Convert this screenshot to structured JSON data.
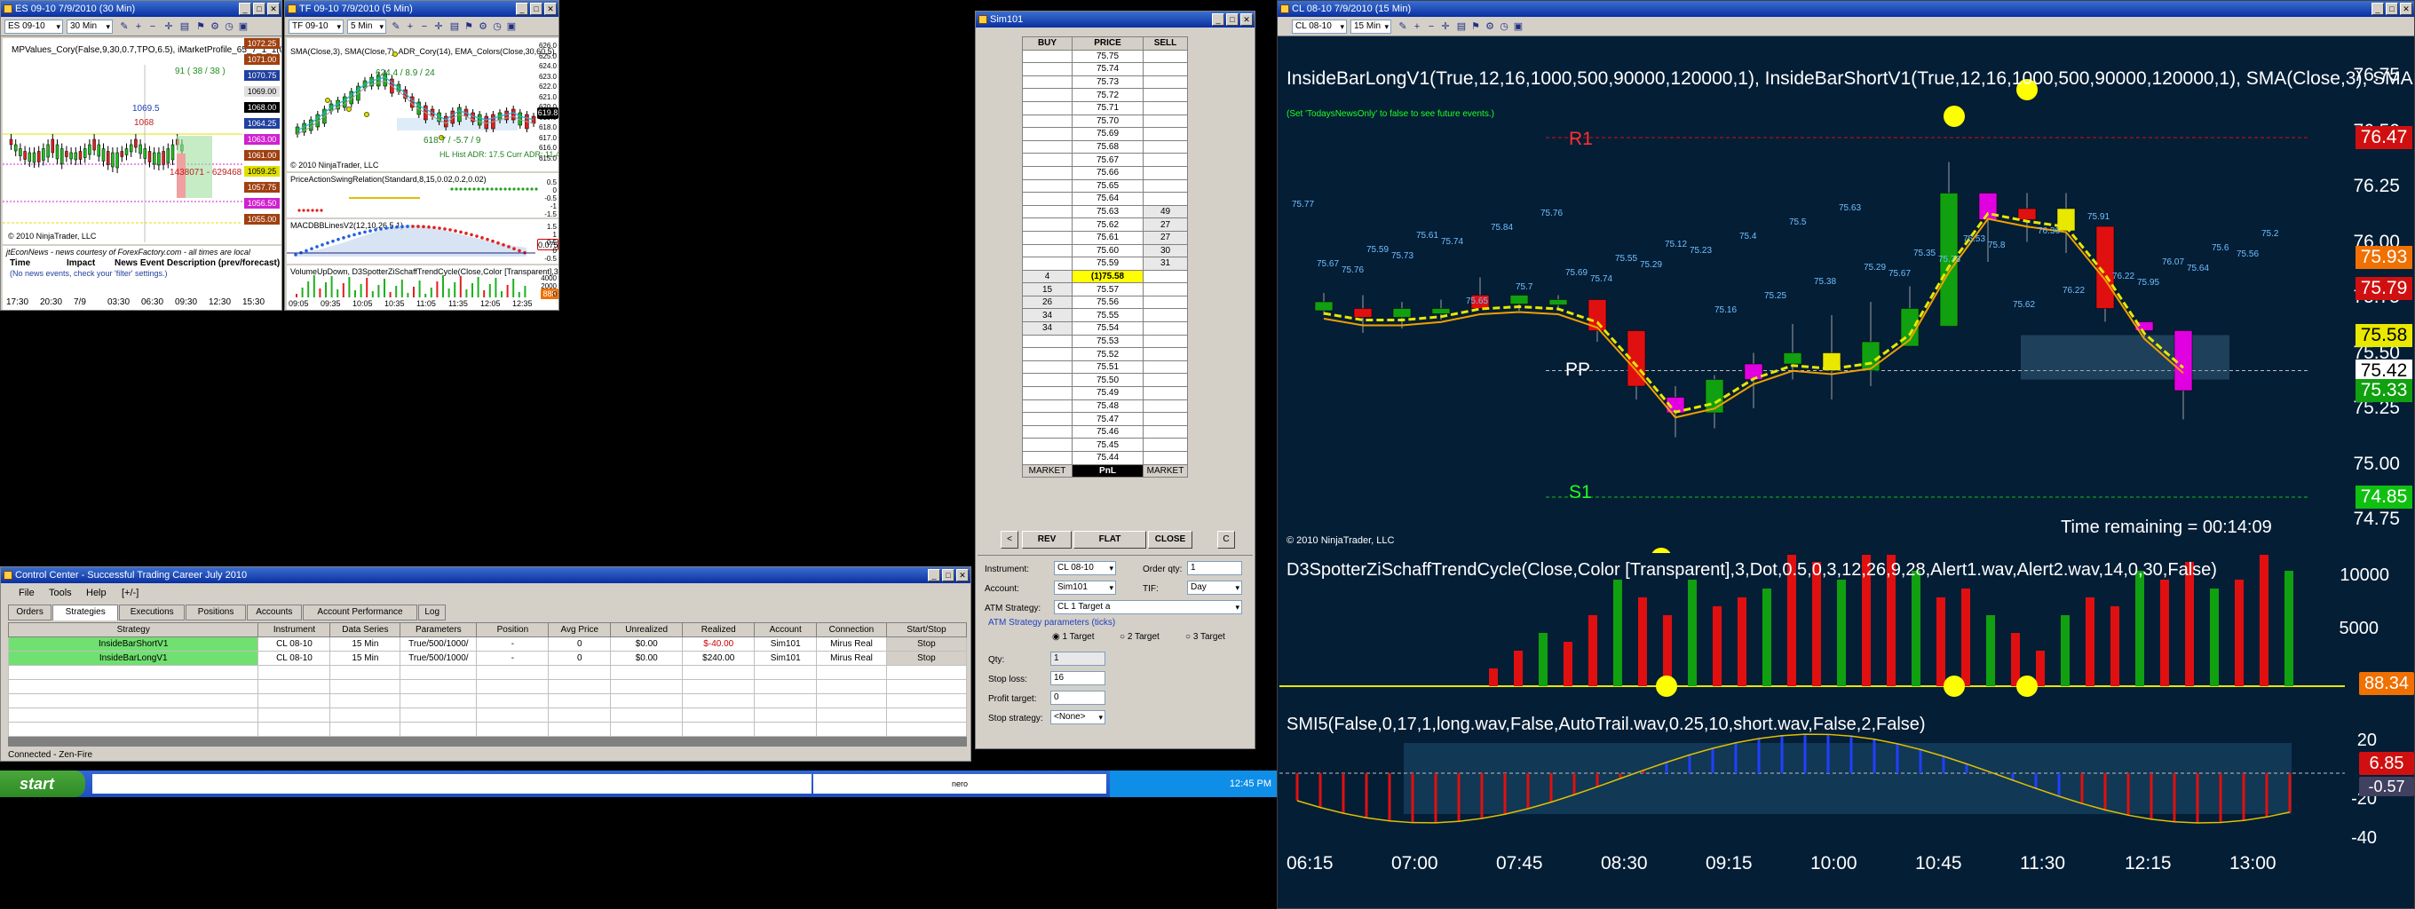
{
  "es_window": {
    "title": "ES 09-10  7/9/2010 (30 Min)",
    "instrument": "ES 09-10",
    "interval": "30 Min",
    "indicator_line": "MPValues_Cory(False,9,30,0.7,TPO,6.5), iMarketProfile_65_7_1_1(0,4,9,30,True,6,5,70)",
    "copyright": "© 2010 NinjaTrader, LLC",
    "price_labels": [
      "1072.25",
      "1071.00",
      "1070.75",
      "1069.00",
      "1068.00",
      "1064.25",
      "1063.00",
      "1061.00",
      "1059.25",
      "1057.75",
      "1056.50",
      "1055.00"
    ],
    "annotations": [
      "91 ( 38 / 38 )",
      "1069.5",
      "1068",
      "1438071 - 629468"
    ],
    "time_axis": [
      "17:30",
      "20:30",
      "7/9",
      "03:30",
      "06:30",
      "09:30",
      "12:30",
      "15:30"
    ],
    "news_header": "jtEconNews - news courtesy of ForexFactory.com - all times are local",
    "news_cols": [
      "Time",
      "Impact",
      "News Event Description (prev/forecast)"
    ],
    "news_empty": "(No news events, check your 'filter' settings.)"
  },
  "tf_window": {
    "title": "TF 09-10  7/9/2010 (5 Min)",
    "instrument": "TF 09-10",
    "interval": "5 Min",
    "indicator_line": "SMA(Close,3), SMA(Close,7), ADR_Cory(14), EMA_Colors(Close,30,60,5), PriceActionSwingABC(Standard,6",
    "copyright": "© 2010 NinjaTrader, LLC",
    "annotation_high": "624.4 / 8.9 / 24",
    "annotation_low": "618.7 / -5.7 / 9",
    "adr": "Hist ADR: 17.5 Curr ADR: 11.4",
    "hl": "HL",
    "current_price": "619.8",
    "price_axis": [
      "626.0",
      "625.0",
      "624.0",
      "623.0",
      "622.0",
      "621.0",
      "620.0",
      "619.0",
      "618.0",
      "617.0",
      "616.0",
      "615.0"
    ],
    "panel2_title": "PriceActionSwingRelation(Standard,8,15,0.02,0.2,0.02)",
    "panel2_axis": [
      "0.5",
      "0",
      "-0.5",
      "-1",
      "-1.5"
    ],
    "panel3_title": "MACDBBLinesV2(12,10,26,5,1)",
    "panel3_axis": [
      "1.5",
      "1",
      "0.5",
      "0",
      "-0.5"
    ],
    "panel3_value": "0.0757",
    "panel4_title": "VolumeUpDown, D3SpotterZiSchaffTrendCycle(Close,Color [Transparent],3,Dot,0.5,0,3,12,26,9,28,Alert1.wav",
    "panel4_axis": [
      "4000",
      "2000",
      "0"
    ],
    "panel4_value": "888",
    "time_axis": [
      "09:05",
      "09:35",
      "10:05",
      "10:35",
      "11:05",
      "11:35",
      "12:05",
      "12:35"
    ]
  },
  "dom": {
    "title": "Sim101",
    "headers": [
      "BUY",
      "PRICE",
      "SELL"
    ],
    "rows": [
      {
        "buy": "",
        "price": "75.75",
        "sell": ""
      },
      {
        "buy": "",
        "price": "75.74",
        "sell": ""
      },
      {
        "buy": "",
        "price": "75.73",
        "sell": ""
      },
      {
        "buy": "",
        "price": "75.72",
        "sell": ""
      },
      {
        "buy": "",
        "price": "75.71",
        "sell": ""
      },
      {
        "buy": "",
        "price": "75.70",
        "sell": ""
      },
      {
        "buy": "",
        "price": "75.69",
        "sell": ""
      },
      {
        "buy": "",
        "price": "75.68",
        "sell": ""
      },
      {
        "buy": "",
        "price": "75.67",
        "sell": ""
      },
      {
        "buy": "",
        "price": "75.66",
        "sell": ""
      },
      {
        "buy": "",
        "price": "75.65",
        "sell": ""
      },
      {
        "buy": "",
        "price": "75.64",
        "sell": ""
      },
      {
        "buy": "",
        "price": "75.63",
        "sell": "49"
      },
      {
        "buy": "",
        "price": "75.62",
        "sell": "27"
      },
      {
        "buy": "",
        "price": "75.61",
        "sell": "27"
      },
      {
        "buy": "",
        "price": "75.60",
        "sell": "30"
      },
      {
        "buy": "",
        "price": "75.59",
        "sell": "31"
      },
      {
        "buy": "4",
        "price": "(1)75.58",
        "sell": ""
      },
      {
        "buy": "15",
        "price": "75.57",
        "sell": ""
      },
      {
        "buy": "26",
        "price": "75.56",
        "sell": ""
      },
      {
        "buy": "34",
        "price": "75.55",
        "sell": ""
      },
      {
        "buy": "34",
        "price": "75.54",
        "sell": ""
      },
      {
        "buy": "",
        "price": "75.53",
        "sell": ""
      },
      {
        "buy": "",
        "price": "75.52",
        "sell": ""
      },
      {
        "buy": "",
        "price": "75.51",
        "sell": ""
      },
      {
        "buy": "",
        "price": "75.50",
        "sell": ""
      },
      {
        "buy": "",
        "price": "75.49",
        "sell": ""
      },
      {
        "buy": "",
        "price": "75.48",
        "sell": ""
      },
      {
        "buy": "",
        "price": "75.47",
        "sell": ""
      },
      {
        "buy": "",
        "price": "75.46",
        "sell": ""
      },
      {
        "buy": "",
        "price": "75.45",
        "sell": ""
      },
      {
        "buy": "",
        "price": "75.44",
        "sell": ""
      }
    ],
    "footer": [
      "MARKET",
      "PnL",
      "MARKET"
    ],
    "buttons": {
      "rev": "REV",
      "flat": "FLAT",
      "close": "CLOSE",
      "left": "<",
      "right": "C"
    },
    "form": {
      "instrument_label": "Instrument:",
      "instrument": "CL 08-10",
      "order_qty_label": "Order qty:",
      "order_qty": "1",
      "account_label": "Account:",
      "account": "Sim101",
      "tif_label": "TIF:",
      "tif": "Day",
      "atm_label": "ATM Strategy:",
      "atm": "CL 1 Target a",
      "params_title": "ATM Strategy parameters (ticks)",
      "targets": [
        "1 Target",
        "2 Target",
        "3 Target"
      ],
      "qty_label": "Qty:",
      "qty": "1",
      "stop_loss_label": "Stop loss:",
      "stop_loss": "16",
      "profit_label": "Profit target:",
      "profit": "0",
      "stop_strategy_label": "Stop strategy:",
      "stop_strategy": "<None>"
    }
  },
  "control_center": {
    "title": "Control Center - Successful Trading Career July 2010",
    "menu": [
      "File",
      "Tools",
      "Help",
      "[+/-]"
    ],
    "tabs": [
      "Orders",
      "Strategies",
      "Executions",
      "Positions",
      "Accounts",
      "Account Performance",
      "Log"
    ],
    "columns": [
      "Strategy",
      "Instrument",
      "Data Series",
      "Parameters",
      "Position",
      "Avg Price",
      "Unrealized",
      "Realized",
      "Account",
      "Connection",
      "Start/Stop"
    ],
    "rows": [
      {
        "strategy": "InsideBarShortV1",
        "instrument": "CL 08-10",
        "series": "15 Min",
        "params": "True/500/1000/",
        "position": "-",
        "avg": "0",
        "unreal": "$0.00",
        "real": "$-40.00",
        "account": "Sim101",
        "conn": "Mirus Real",
        "btn": "Stop"
      },
      {
        "strategy": "InsideBarLongV1",
        "instrument": "CL 08-10",
        "series": "15 Min",
        "params": "True/500/1000/",
        "position": "-",
        "avg": "0",
        "unreal": "$0.00",
        "real": "$240.00",
        "account": "Sim101",
        "conn": "Mirus Real",
        "btn": "Stop"
      }
    ],
    "status": "Connected - Zen-Fire"
  },
  "taskbar": {
    "start": "start",
    "clock": "12:45 PM",
    "app": "nero"
  },
  "cl_window": {
    "title": "CL 08-10  7/9/2010 (15 Min)",
    "instrument": "CL 08-10",
    "interval": "15 Min",
    "indicator_line": "InsideBarLongV1(True,12,16,1000,500,90000,120000,1),  InsideBarShortV1(True,12,16,1000,500,90000,120000,1),  SMA(Close,3),  SMA(C",
    "news_note": "(Set 'TodaysNewsOnly' to false to see future events.)",
    "pivots": {
      "r1": "R1",
      "pp": "PP",
      "s1": "S1"
    },
    "copyright": "© 2010 NinjaTrader, LLC",
    "time_remaining": "Time remaining = 00:14:09",
    "price_axis": [
      "76.75",
      "76.50",
      "76.25",
      "76.00",
      "75.75",
      "75.50",
      "75.25",
      "75.00",
      "74.75"
    ],
    "price_boxes": [
      {
        "v": "76.47",
        "c": "#d01010"
      },
      {
        "v": "75.93",
        "c": "#f07000"
      },
      {
        "v": "75.79",
        "c": "#d01010"
      },
      {
        "v": "75.58",
        "c": "#e8e800"
      },
      {
        "v": "75.42",
        "c": "#ffffff"
      },
      {
        "v": "75.33",
        "c": "#10a010"
      },
      {
        "v": "74.85",
        "c": "#10c010"
      }
    ],
    "bar_labels": [
      "75.77",
      "75.67",
      "75.76",
      "75.59",
      "75.73",
      "75.61",
      "75.74",
      "75.65",
      "75.84",
      "75.7",
      "75.76",
      "75.69",
      "75.74",
      "75.55",
      "75.29",
      "75.12",
      "75.23",
      "75.16",
      "75.4",
      "75.25",
      "75.5",
      "75.38",
      "75.63",
      "75.29",
      "75.67",
      "75.35",
      "75.73",
      "75.53",
      "75.8",
      "75.62",
      "76.36",
      "76.22",
      "75.91",
      "76.22",
      "75.95",
      "76.07",
      "75.64",
      "75.6",
      "75.56",
      "75.2"
    ],
    "panel2_title": "D3SpotterZiSchaffTrendCycle(Close,Color  [Transparent],3,Dot,0.5,0,3,12,26,9,28,Alert1.wav,Alert2.wav,14,0,30,False)",
    "panel2_axis": [
      "10000",
      "5000"
    ],
    "panel2_value": "88.34",
    "panel3_title": "SMI5(False,0,17,1,long.wav,False,AutoTrail.wav,0.25,10,short.wav,False,2,False)",
    "panel3_axis": [
      "20",
      "0",
      "-20",
      "-40"
    ],
    "panel3_value": "6.85",
    "panel3_value2": "-0.57",
    "time_axis": [
      "06:15",
      "07:00",
      "07:45",
      "08:30",
      "09:15",
      "10:00",
      "10:45",
      "11:30",
      "12:15",
      "13:00"
    ]
  },
  "colors": {
    "up": "#10a010",
    "down": "#e01010",
    "inside_long": "#e8e800",
    "inside_short": "#e000e0",
    "chart_dark": "#041e36"
  }
}
